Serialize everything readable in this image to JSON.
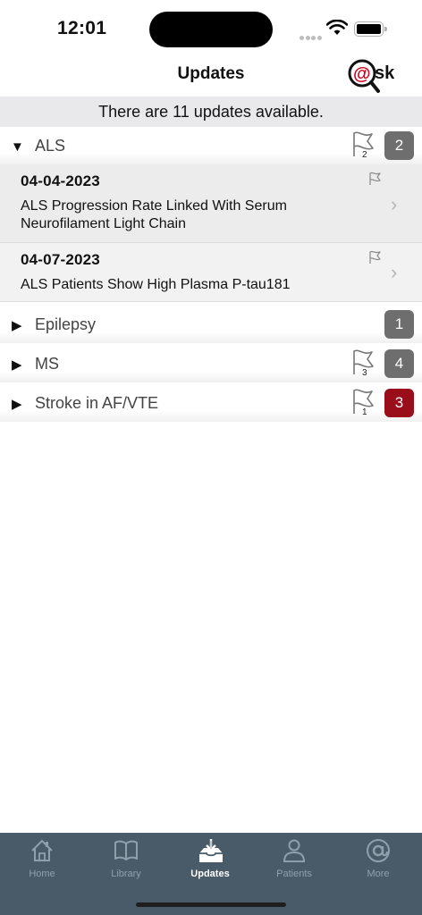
{
  "status": {
    "time": "12:01"
  },
  "header": {
    "title": "Updates",
    "logo_text": "@sk"
  },
  "banner": {
    "text": "There are 11 updates available."
  },
  "sections": [
    {
      "name": "ALS",
      "expanded": true,
      "flag_count": "2",
      "count": "2",
      "items": [
        {
          "date": "04-04-2023",
          "title": "ALS Progression Rate Linked With Serum Neurofilament Light Chain"
        },
        {
          "date": "04-07-2023",
          "title": "ALS Patients Show High Plasma P-tau181"
        }
      ]
    },
    {
      "name": "Epilepsy",
      "expanded": false,
      "flag_count": "",
      "count": "1"
    },
    {
      "name": "MS",
      "expanded": false,
      "flag_count": "3",
      "count": "4"
    },
    {
      "name": "Stroke in AF/VTE",
      "expanded": false,
      "flag_count": "1",
      "count": "3"
    }
  ],
  "colors": {
    "alert_badge": "#9a0e1c",
    "normal_badge": "#6e6e6e",
    "tab_bar": "#495b68",
    "logo_red": "#d0021b"
  },
  "tabs": [
    {
      "label": "Home",
      "icon": "home-icon",
      "active": false
    },
    {
      "label": "Library",
      "icon": "book-icon",
      "active": false
    },
    {
      "label": "Updates",
      "icon": "inbox-download-icon",
      "active": true
    },
    {
      "label": "Patients",
      "icon": "person-icon",
      "active": false
    },
    {
      "label": "More",
      "icon": "at-icon",
      "active": false
    }
  ]
}
